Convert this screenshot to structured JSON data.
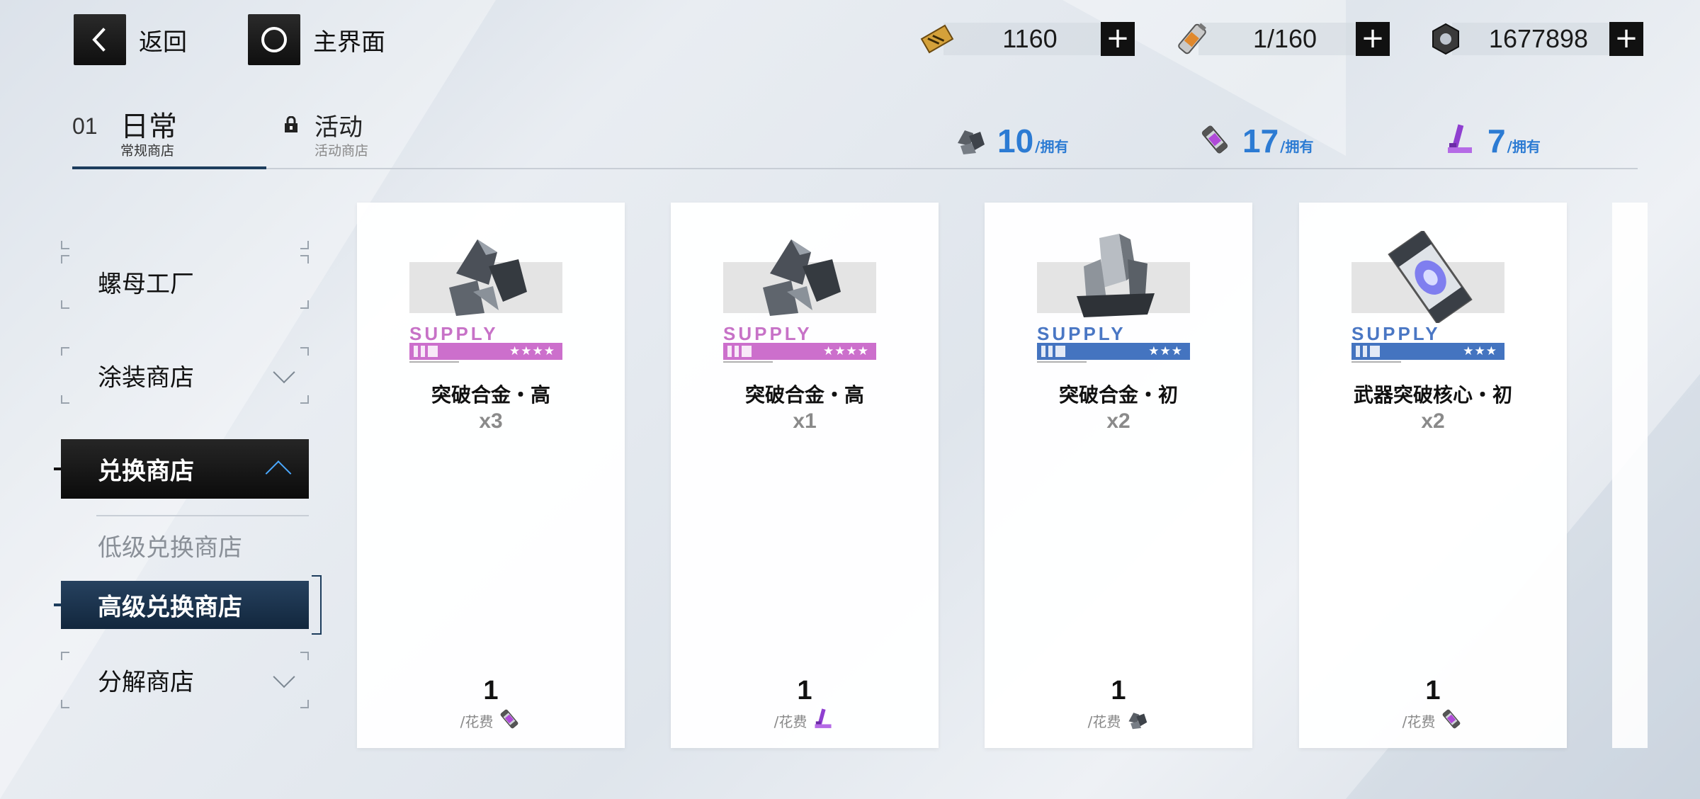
{
  "nav": {
    "back_label": "返回",
    "home_label": "主界面"
  },
  "resources": [
    {
      "icon": "gold-ticket-icon",
      "value": "1160"
    },
    {
      "icon": "battery-icon",
      "value": "1/160"
    },
    {
      "icon": "hex-nut-icon",
      "value": "1677898"
    }
  ],
  "tabs": {
    "daily": {
      "number": "01",
      "title": "日常",
      "subtitle": "常规商店"
    },
    "event": {
      "title": "活动",
      "subtitle": "活动商店"
    }
  },
  "owned": [
    {
      "icon": "alloy-ore-icon",
      "count": "10",
      "suffix": "/拥有"
    },
    {
      "icon": "core-capsule-icon",
      "count": "17",
      "suffix": "/拥有"
    },
    {
      "icon": "purple-token-icon",
      "count": "7",
      "suffix": "/拥有"
    }
  ],
  "sidebar": {
    "factory": "螺母工厂",
    "skin_shop": "涂装商店",
    "exchange_shop": "兑换商店",
    "low_exchange": "低级兑换商店",
    "high_exchange": "高级兑换商店",
    "decompose_shop": "分解商店"
  },
  "items": [
    {
      "name": "突破合金・高",
      "qty": "x3",
      "supply": "SUPPLY",
      "stars": "★★★★",
      "rarity": "purple",
      "price": "1",
      "cost_label": "/花费",
      "cost_icon": "core-capsule-icon",
      "art": "alloy-high-icon"
    },
    {
      "name": "突破合金・高",
      "qty": "x1",
      "supply": "SUPPLY",
      "stars": "★★★★",
      "rarity": "purple",
      "price": "1",
      "cost_label": "/花费",
      "cost_icon": "purple-token-icon",
      "art": "alloy-high-icon"
    },
    {
      "name": "突破合金・初",
      "qty": "x2",
      "supply": "SUPPLY",
      "stars": "★★★",
      "rarity": "blue",
      "price": "1",
      "cost_label": "/花费",
      "cost_icon": "alloy-ore-icon",
      "art": "alloy-basic-icon"
    },
    {
      "name": "武器突破核心・初",
      "qty": "x2",
      "supply": "SUPPLY",
      "stars": "★★★",
      "rarity": "blue",
      "price": "1",
      "cost_label": "/花费",
      "cost_icon": "core-capsule-icon",
      "art": "weapon-core-icon"
    }
  ],
  "colors": {
    "accent_blue": "#2c7bd3",
    "purple_rarity": "#cc6fcc",
    "blue_rarity": "#4474c0",
    "selected_dark": "#12273d"
  }
}
